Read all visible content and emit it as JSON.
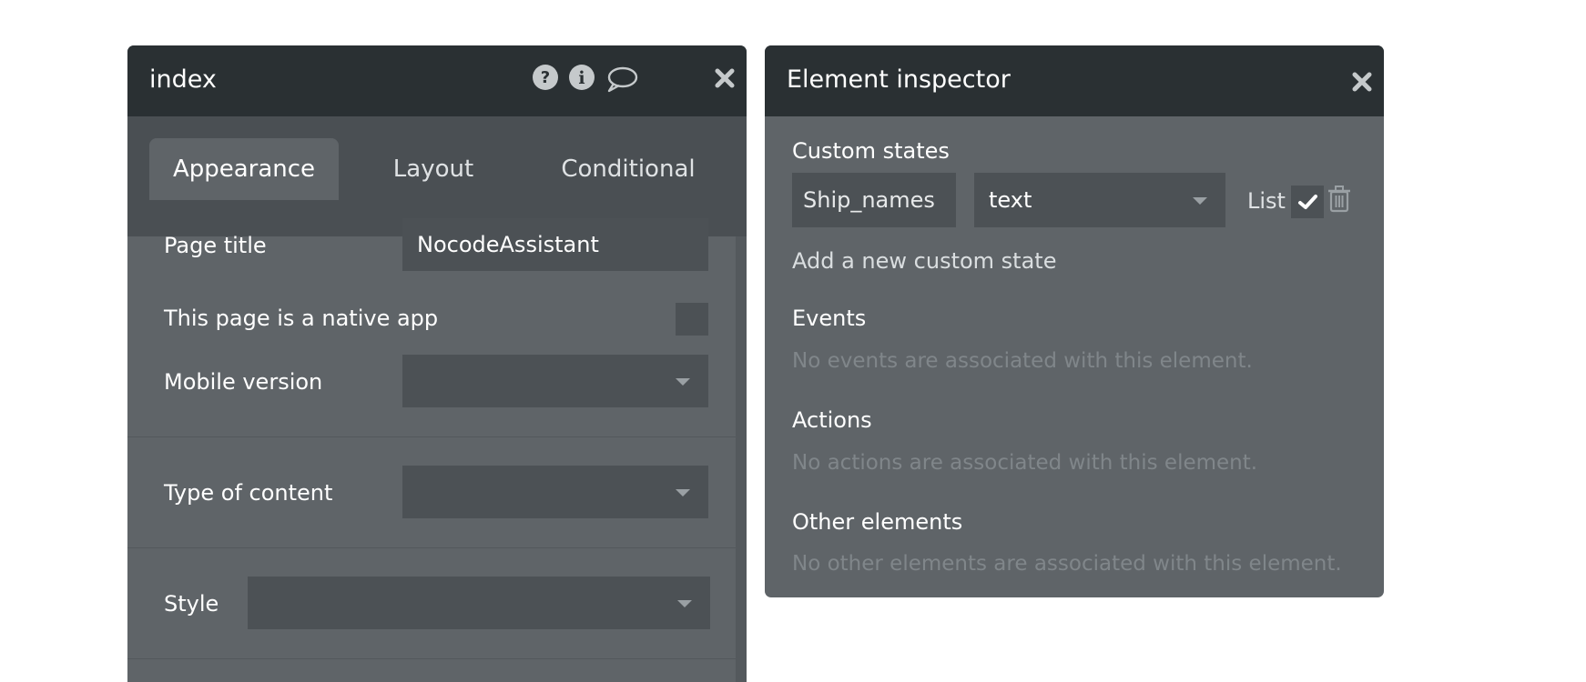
{
  "left_panel": {
    "title": "index",
    "icons": [
      "question-circle-icon",
      "info-circle-icon",
      "comment-icon",
      "close-icon"
    ],
    "tabs": [
      {
        "label": "Appearance",
        "active": true
      },
      {
        "label": "Layout",
        "active": false
      },
      {
        "label": "Conditional",
        "active": false
      }
    ],
    "page_title": {
      "label": "Page title",
      "value": "NocodeAssistant"
    },
    "native_app": {
      "label": "This page is a native app",
      "checked": false
    },
    "mobile_version": {
      "label": "Mobile version",
      "value": ""
    },
    "type_of_content": {
      "label": "Type of content",
      "value": ""
    },
    "style": {
      "label": "Style",
      "value": ""
    }
  },
  "right_panel": {
    "title": "Element inspector",
    "custom_states": {
      "heading": "Custom states",
      "state_name": "Ship_names",
      "state_type": "text",
      "list_label": "List",
      "list_checked": true,
      "add_link": "Add a new custom state"
    },
    "events": {
      "heading": "Events",
      "empty_text": "No events are associated with this element."
    },
    "actions": {
      "heading": "Actions",
      "empty_text": "No actions are associated with this element."
    },
    "other_elements": {
      "heading": "Other elements",
      "empty_text": "No other elements are associated with this element."
    }
  },
  "colors": {
    "header": "#2a3033",
    "panel": "#5f6468",
    "field": "#4c5155",
    "muted_text": "#80868a"
  }
}
